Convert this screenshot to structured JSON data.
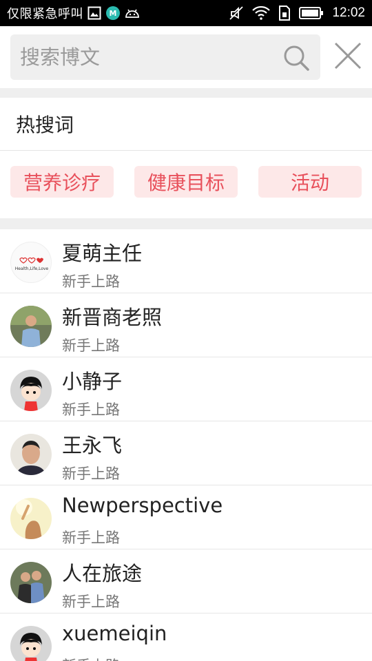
{
  "status_bar": {
    "carrier": "仅限紧急呼叫",
    "time": "12:02",
    "icons": [
      "gallery-icon",
      "app-badge-icon",
      "android-icon",
      "mute-icon",
      "wifi-icon",
      "sim-icon",
      "battery-icon"
    ],
    "app_badge_letter": "M"
  },
  "search": {
    "placeholder": "搜索博文",
    "value": ""
  },
  "hot_words": {
    "title": "热搜词",
    "tags": [
      {
        "label": "营养诊疗"
      },
      {
        "label": "健康目标"
      },
      {
        "label": "活动"
      }
    ]
  },
  "users": [
    {
      "name": "夏萌主任",
      "level": "新手上路",
      "avatar": "logo-avatar",
      "avatar_text": "Health,Life,Love"
    },
    {
      "name": "新晋商老照",
      "level": "新手上路",
      "avatar": "photo-avatar"
    },
    {
      "name": "小静子",
      "level": "新手上路",
      "avatar": "cartoon-girl-avatar"
    },
    {
      "name": "王永飞",
      "level": "新手上路",
      "avatar": "photo-avatar"
    },
    {
      "name": "Newperspective",
      "level": "新手上路",
      "avatar": "photo-avatar"
    },
    {
      "name": "人在旅途",
      "level": "新手上路",
      "avatar": "photo-avatar"
    },
    {
      "name": "xuemeiqin",
      "level": "新手上路",
      "avatar": "cartoon-girl-avatar"
    }
  ],
  "colors": {
    "accent": "#e8505b",
    "tag_bg": "#fde8e8",
    "band": "#efefef"
  }
}
